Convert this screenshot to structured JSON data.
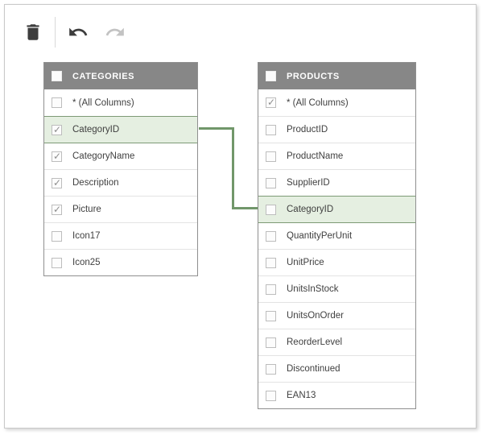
{
  "toolbar": {
    "buttons": [
      {
        "id": "delete",
        "icon": "trash-icon",
        "enabled": true
      },
      {
        "id": "undo",
        "icon": "undo-icon",
        "enabled": true
      },
      {
        "id": "redo",
        "icon": "redo-icon",
        "enabled": false
      }
    ]
  },
  "colors": {
    "header_bg": "#878787",
    "header_text": "#ffffff",
    "row_text": "#404040",
    "highlight_bg": "#e5efe1",
    "highlight_border": "#7d9a76",
    "connector": "#71976a",
    "table_border": "#8f8f8f",
    "row_divider": "#e3e3e3"
  },
  "tables": [
    {
      "title": "CATEGORIES",
      "header_checked": false,
      "columns": [
        {
          "label": "* (All Columns)",
          "checked": false,
          "highlighted": false
        },
        {
          "label": "CategoryID",
          "checked": true,
          "highlighted": true
        },
        {
          "label": "CategoryName",
          "checked": true,
          "highlighted": false
        },
        {
          "label": "Description",
          "checked": true,
          "highlighted": false
        },
        {
          "label": "Picture",
          "checked": true,
          "highlighted": false
        },
        {
          "label": "Icon17",
          "checked": false,
          "highlighted": false
        },
        {
          "label": "Icon25",
          "checked": false,
          "highlighted": false
        }
      ]
    },
    {
      "title": "PRODUCTS",
      "header_checked": false,
      "columns": [
        {
          "label": "* (All Columns)",
          "checked": true,
          "highlighted": false
        },
        {
          "label": "ProductID",
          "checked": false,
          "highlighted": false
        },
        {
          "label": "ProductName",
          "checked": false,
          "highlighted": false
        },
        {
          "label": "SupplierID",
          "checked": false,
          "highlighted": false
        },
        {
          "label": "CategoryID",
          "checked": false,
          "highlighted": true
        },
        {
          "label": "QuantityPerUnit",
          "checked": false,
          "highlighted": false
        },
        {
          "label": "UnitPrice",
          "checked": false,
          "highlighted": false
        },
        {
          "label": "UnitsInStock",
          "checked": false,
          "highlighted": false
        },
        {
          "label": "UnitsOnOrder",
          "checked": false,
          "highlighted": false
        },
        {
          "label": "ReorderLevel",
          "checked": false,
          "highlighted": false
        },
        {
          "label": "Discontinued",
          "checked": false,
          "highlighted": false
        },
        {
          "label": "EAN13",
          "checked": false,
          "highlighted": false
        }
      ]
    }
  ],
  "relation": {
    "from_table": "CATEGORIES",
    "from_column": "CategoryID",
    "to_table": "PRODUCTS",
    "to_column": "CategoryID"
  }
}
